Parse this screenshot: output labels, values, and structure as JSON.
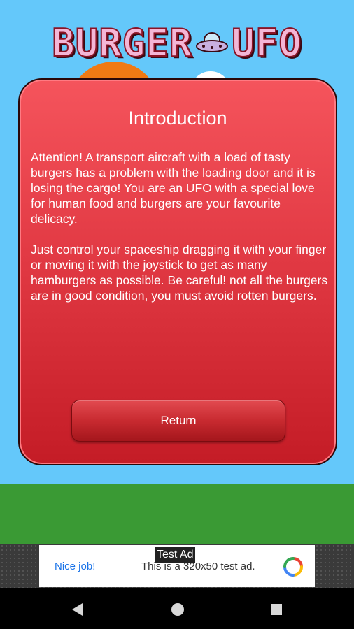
{
  "app": {
    "title_left": "BURGER",
    "title_right": "UFO"
  },
  "icons": {
    "logo_ufo": "ufo-icon",
    "back": "back-triangle-icon",
    "home": "home-circle-icon",
    "recents": "recents-square-icon",
    "ad_brand": "admob-logo-icon"
  },
  "dialog": {
    "title": "Introduction",
    "paragraph1": "Attention! A transport aircraft with a load of tasty burgers has a problem with the loading door and it is losing the cargo! You are an UFO with a special love for human food and burgers are your favourite delicacy.",
    "paragraph2": "Just control your spaceship dragging it with your finger or moving it with the joystick to get as many hamburgers as possible. Be careful! not all the burgers are in good condition, you must avoid rotten burgers.",
    "return_label": "Return"
  },
  "ad": {
    "label": "Test Ad",
    "nice": "Nice job!",
    "text": "This is a 320x50 test ad."
  },
  "colors": {
    "sky": "#64c8fa",
    "ground": "#3a9a34",
    "dialog_red": "#e23a44",
    "sun": "#f07a14",
    "ad_link": "#1a73e8"
  }
}
